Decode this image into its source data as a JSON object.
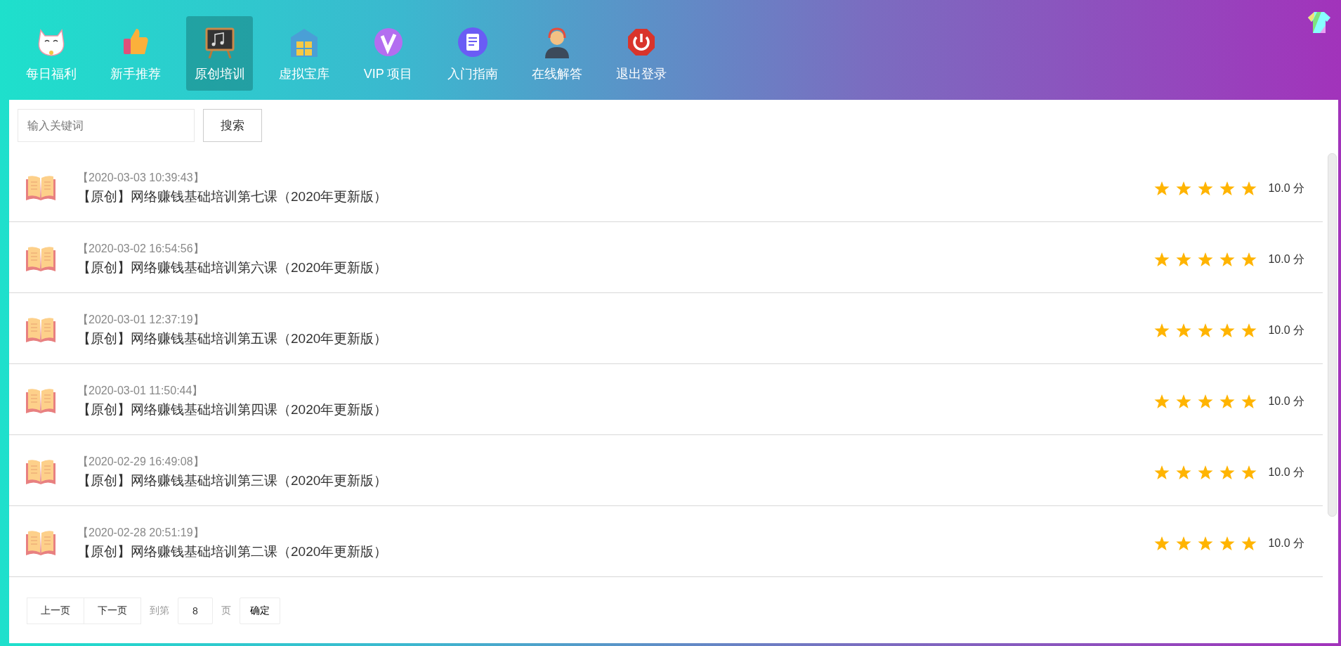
{
  "nav": [
    {
      "label": "每日福利",
      "selected": false
    },
    {
      "label": "新手推荐",
      "selected": false
    },
    {
      "label": "原创培训",
      "selected": true
    },
    {
      "label": "虚拟宝库",
      "selected": false
    },
    {
      "label": "VIP 项目",
      "selected": false
    },
    {
      "label": "入门指南",
      "selected": false
    },
    {
      "label": "在线解答",
      "selected": false
    },
    {
      "label": "退出登录",
      "selected": false
    }
  ],
  "search": {
    "placeholder": "输入关键词",
    "button": "搜索"
  },
  "items": [
    {
      "date": "【2020-03-03 10:39:43】",
      "title": "【原创】网络赚钱基础培训第七课（2020年更新版）",
      "stars": 5,
      "score": "10.0 分"
    },
    {
      "date": "【2020-03-02 16:54:56】",
      "title": "【原创】网络赚钱基础培训第六课（2020年更新版）",
      "stars": 5,
      "score": "10.0 分"
    },
    {
      "date": "【2020-03-01 12:37:19】",
      "title": "【原创】网络赚钱基础培训第五课（2020年更新版）",
      "stars": 5,
      "score": "10.0 分"
    },
    {
      "date": "【2020-03-01 11:50:44】",
      "title": "【原创】网络赚钱基础培训第四课（2020年更新版）",
      "stars": 5,
      "score": "10.0 分"
    },
    {
      "date": "【2020-02-29 16:49:08】",
      "title": "【原创】网络赚钱基础培训第三课（2020年更新版）",
      "stars": 5,
      "score": "10.0 分"
    },
    {
      "date": "【2020-02-28 20:51:19】",
      "title": "【原创】网络赚钱基础培训第二课（2020年更新版）",
      "stars": 5,
      "score": "10.0 分"
    }
  ],
  "pagination": {
    "prev": "上一页",
    "next": "下一页",
    "goto_label": "到第",
    "page_value": "8",
    "page_unit": "页",
    "confirm": "确定"
  }
}
